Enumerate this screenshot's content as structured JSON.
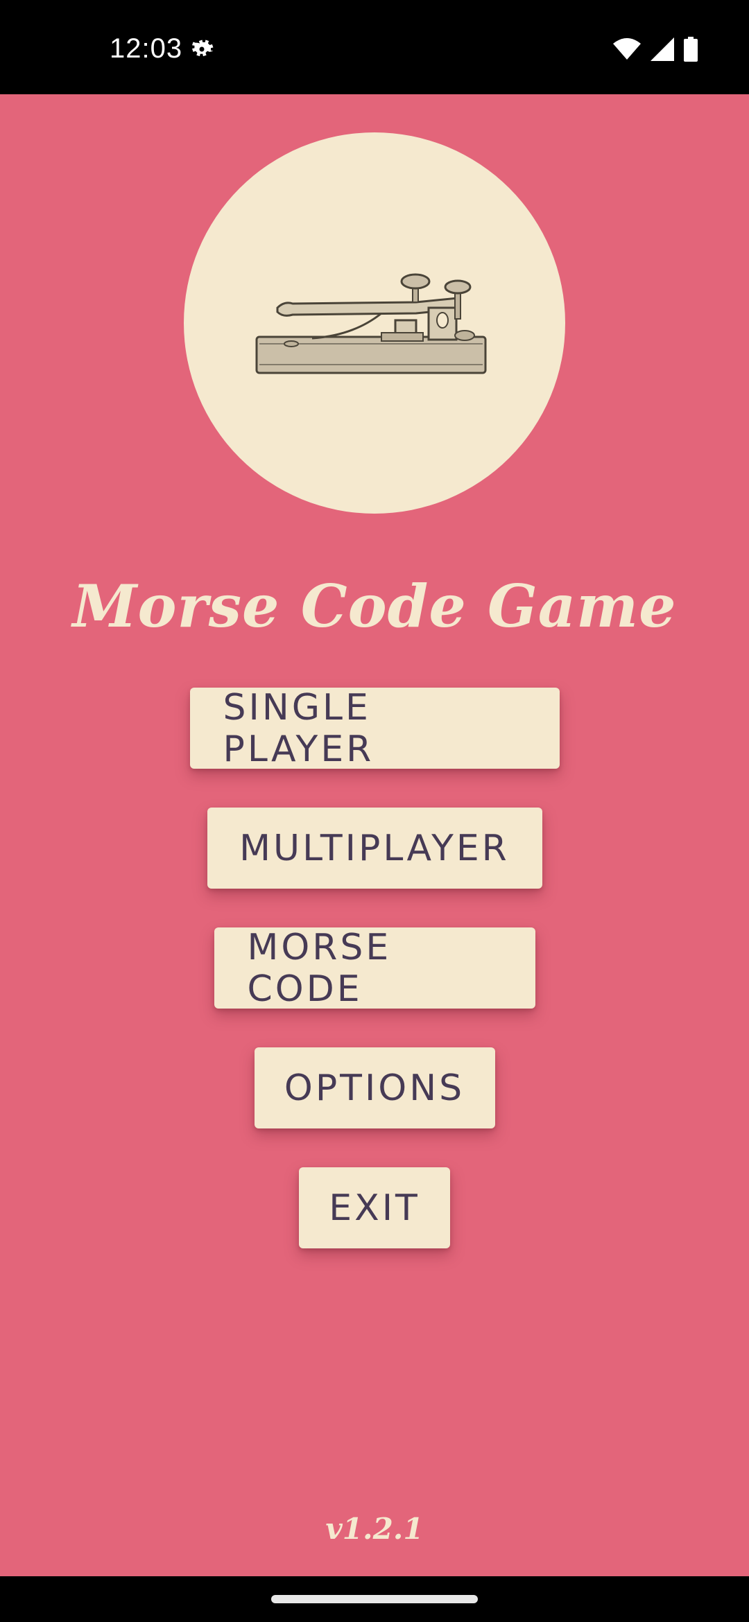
{
  "status_bar": {
    "time": "12:03",
    "icons": [
      "settings-gear-icon",
      "wifi-icon",
      "cellular-signal-icon",
      "battery-icon"
    ]
  },
  "app": {
    "title": "Morse Code Game",
    "hero_icon": "telegraph-key-icon",
    "version": "v1.2.1",
    "colors": {
      "background": "#e3657a",
      "cream": "#f5e9cf",
      "button_text": "#463a55"
    }
  },
  "menu": {
    "single_player": "SINGLE PLAYER",
    "multiplayer": "MULTIPLAYER",
    "morse_code": "MORSE CODE",
    "options": "OPTIONS",
    "exit": "EXIT"
  }
}
